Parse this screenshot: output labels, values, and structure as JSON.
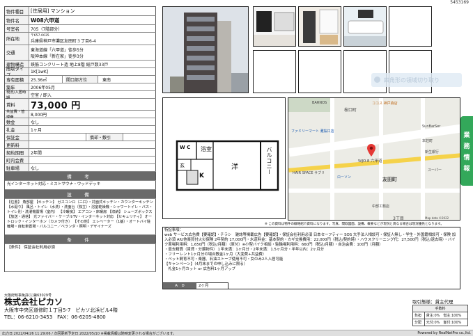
{
  "listing_id": "5453169",
  "property": {
    "type_label": "物件種目",
    "type_value": "[住居用] マンション",
    "name_label": "物件名",
    "name_value": "W08六甲道",
    "room_label": "号室名",
    "room_value": "705（7階部分）",
    "address_label": "所在地",
    "address_zip": "〒657-0035",
    "address_value": "兵庫県神戸市灘区友田町３丁目6-4",
    "transport_label": "交通",
    "transport_line1": "東海道線「六甲道」徒歩5分",
    "transport_line2": "阪神本線「新在家」徒歩3分",
    "structure_label": "建物構造",
    "structure_value": "鉄筋コンクリート造 地上8階 総戸数33戸",
    "layout_label": "間取タイプ",
    "layout_value": "1K[1wK]",
    "area_label": "専有面積",
    "area_value": "25.36㎡",
    "direction_label": "開口部方位",
    "direction_value": "東南",
    "age_label": "築年",
    "age_value": "2006年05月",
    "status_label": "現況/入居時期",
    "status_value": "空室 / 即入",
    "rent_label": "賃料",
    "rent_value": "73,000 円",
    "fee_label": "共益費・管理費",
    "fee_value": "8,000円",
    "deposit_label": "敷金",
    "deposit_value": "なし",
    "key_label": "礼金",
    "key_value": "1ヶ月",
    "guarantee_label": "保証金",
    "sub_label": "償却・敷引",
    "sub_value": "",
    "renew_label": "更新料",
    "renew_value": "",
    "term_label": "契約期間",
    "term_value": "2年間",
    "insurance_label": "町内会費",
    "insurance_value": "",
    "parking_label": "駐車場",
    "parking_value": "なし"
  },
  "sections": {
    "remarks_title": "備　考",
    "remarks_text": "光インターネット対応・ミストサウナ・ウッドデッキ",
    "equipment_title": "設　備",
    "equipment_text": "【位置】 角部屋 【キッチン】 ガスコンロ（二口）・対面式キッチン・カウンターキッチン 【水廻り】 風呂・トイレ（水洗）・洗面台（独立）・浴室乾燥機・シャワートイレ・バス・トイレ別・洗濯機置場（室内） 【冷暖房】 エアコン・床暖房 【収納】 シューズボックス 【放送・通信】 光ファイバー・ケーブルTV・インターネット対応 【セキュリティ】 オートロック・インターホン（カメラ付き） 【その他】 エレベーター（1基）・オートバイ駐輪場・自転車置場・バルコニー／ベランダ・照明・デザイナーズ",
    "conditions_title": "条　件",
    "conditions_text": "【条件】 保証会社利用必須"
  },
  "floor_plan": {
    "wc": "W C",
    "bath": "浴室",
    "western": "洋",
    "kitchen": "K",
    "balcony": "バルコニー",
    "genkan": "玄"
  },
  "map": {
    "labels": [
      "桜口町",
      "BARNOS",
      "ココス 神戸森店",
      "ファミリーマート 灘桜口店",
      "WJO.8 六甲道",
      "友田町",
      "ローソン",
      "HAIR SPACE サブリ",
      "本荘町",
      "SunBarSer",
      "新生銀行",
      "スーパー",
      "中部工務店",
      "3丁目",
      "Map data ©2022"
    ],
    "marker_label": "W08六甲道"
  },
  "notes": {
    "title": "特記事項：",
    "text1": "web サービス広告費【要確認】・チラシ　雑誌等掲載広告【要確認】・保証会社利用必須 日本セーフティー SOS 大手法人相談可・保証人無し・学生・外国籍相談可・保険 加入必須 AIU他楽買付火災保険 2年契約 17,000円・水道料金：基本契約・カギ交換費用：22,000円（税込/契約時）・ハウスクリーニング代：27,500円（税込/退去時）・バイク置場利用料：1,650円（税込/月額）（原付）※小型バイク相談・駐輪場利用料：660円（税込/月額）・自治会費：100円（月額）",
    "text2": "・退去精算（賃貸・分譲物件）１年未満：1ヶ月分・2年未満：1.5ヶ月分・半年以内：2ヶ月分",
    "text3": "・フリーレント1ヶ月分の場合敷金1ヶ月（大変費+共益費）",
    "text4": "・ペット飼育不可・楽器、石油ストーブ使用不可・女のみ2人入居可能",
    "text5": "【キャンペーン】（4月末までの申し込みに限る）",
    "text6": "　礼金1ヶ月カット or 広告料1ヶ月アップ",
    "ad_label": "A　D",
    "ad_value": "2ヶ月",
    "disclaimer": "※ この資料は物件の概略紹介資料になります。写真、間取図面、設備、概要などが現況と異なる場合は現況優先となります。"
  },
  "company": {
    "license": "大阪府知事免許(1)第63029号",
    "name": "株式会社ピカソ",
    "address": "大阪市中央区道修町１丁目5-7　ピカソ北浜ビル4階",
    "phone": "TEL：06-6210-3453　FAX：06-6205-4800"
  },
  "dealer": {
    "mode_label": "取引態様：貸主代理",
    "fee_title": "手数料",
    "row1_label": "負担",
    "row1_value": "貸主:0%　借主:100%",
    "row2_label": "分配",
    "row2_value": "元付:0%　客付:100%"
  },
  "bottom": {
    "left": "出力日:2022/04/26 11:29:06 / 次回更新予定日:2022/05/10 ※掲載情報は随時変更される場合がございます。",
    "right": "Powered by RealNetPro co.,ltd."
  },
  "side_tab": [
    "業",
    "務",
    "情",
    "報"
  ],
  "ghost_tip": "四角形の領域切り取り"
}
